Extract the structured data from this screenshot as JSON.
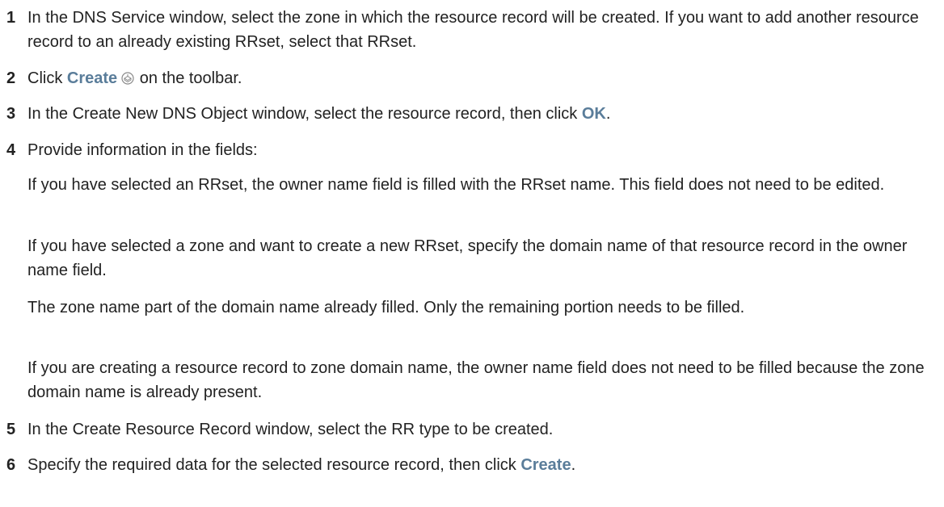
{
  "steps": [
    {
      "number": "1",
      "text": "In the DNS Service window, select the zone in which the resource record will be created. If you want to add another resource record to an already existing RRset, select that RRset."
    },
    {
      "number": "2",
      "before": "Click ",
      "ui": "Create",
      "after": " on the toolbar."
    },
    {
      "number": "3",
      "before": "In the Create New DNS Object window, select the resource record, then click ",
      "ui": "OK",
      "after": "."
    },
    {
      "number": "4",
      "text": "Provide information in the fields:"
    },
    {
      "number": "5",
      "text": "In the Create Resource Record window, select the RR type to be created."
    },
    {
      "number": "6",
      "before": "Specify the required data for the selected resource record, then click ",
      "ui": "Create",
      "after": "."
    }
  ],
  "step4_paragraphs": [
    "If you have selected an RRset, the owner name field is filled with the RRset name. This field does not need to be edited.",
    "If you have selected a zone and want to create a new RRset, specify the domain name of that resource record in the owner name field.",
    "The zone name part of the domain name already filled. Only the remaining portion needs to be filled.",
    "If you are creating a resource record to zone domain name, the owner name field does not need to be filled because the zone domain name is already present."
  ],
  "icons": {
    "create": "create-toolbar-icon"
  },
  "colors": {
    "ui_reference": "#5a7d9a",
    "text": "#222222"
  }
}
